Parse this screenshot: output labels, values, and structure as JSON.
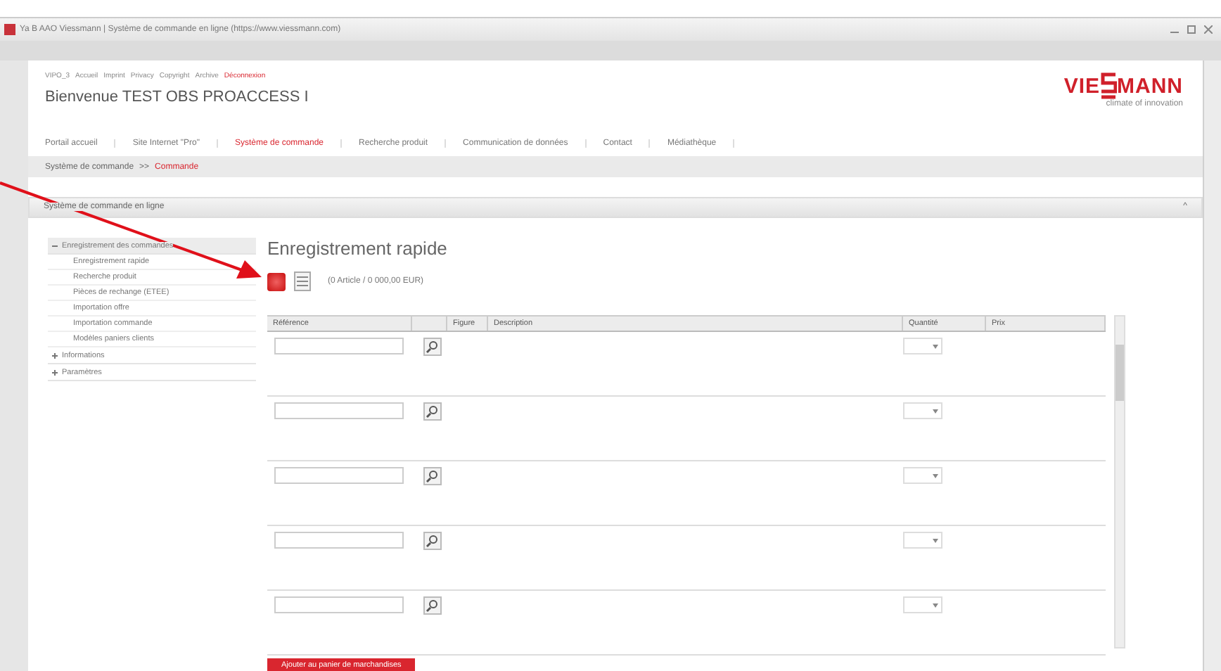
{
  "window": {
    "title": "Ya B AAO Viessmann | Système de commande en ligne (https://www.viessmann.com)"
  },
  "top_links": [
    {
      "label": "VIPO_3",
      "selected": false
    },
    {
      "label": "Accueil",
      "selected": false
    },
    {
      "label": "Imprint",
      "selected": false
    },
    {
      "label": "Privacy",
      "selected": false
    },
    {
      "label": "Copyright",
      "selected": false
    },
    {
      "label": "Archive",
      "selected": false
    },
    {
      "label": "Déconnexion",
      "selected": true
    }
  ],
  "welcome": "Bienvenue TEST OBS PROACCESS I",
  "logo": {
    "left": "VIE",
    "right": "MANN",
    "tagline": "climate of innovation"
  },
  "nav": [
    {
      "label": "Portail accueil",
      "selected": false
    },
    {
      "label": "Site Internet \"Pro\"",
      "selected": false
    },
    {
      "label": "Système de commande",
      "selected": true
    },
    {
      "label": "Recherche produit",
      "selected": false
    },
    {
      "label": "Communication de données",
      "selected": false
    },
    {
      "label": "Contact",
      "selected": false
    },
    {
      "label": "Médiathèque",
      "selected": false
    }
  ],
  "breadcrumb": [
    {
      "label": "Système de commande",
      "selected": false
    },
    {
      "label": ">>",
      "selected": false
    },
    {
      "label": "Commande",
      "selected": true
    }
  ],
  "panel": {
    "title": "Système de commande en ligne",
    "collapse": "^"
  },
  "sidebar": [
    {
      "label": "Enregistrement des commandes",
      "expanded": true,
      "children": [
        {
          "label": "Enregistrement rapide"
        },
        {
          "label": "Recherche produit"
        },
        {
          "label": "Pièces de rechange (ETEE)"
        },
        {
          "label": "Importation offre"
        },
        {
          "label": "Importation commande"
        },
        {
          "label": "Modèles paniers clients"
        }
      ]
    },
    {
      "label": "Informations",
      "expanded": false
    },
    {
      "label": "Paramètres",
      "expanded": false
    }
  ],
  "heading": "Enregistrement rapide",
  "summary": "(0 Article / 0 000,00 EUR)",
  "table": {
    "columns": [
      "Référence",
      "",
      "Figure",
      "Description",
      "Quantité",
      "Prix"
    ]
  },
  "add_button": "Ajouter au panier de marchandises",
  "annotation": {
    "kind": "arrow"
  }
}
